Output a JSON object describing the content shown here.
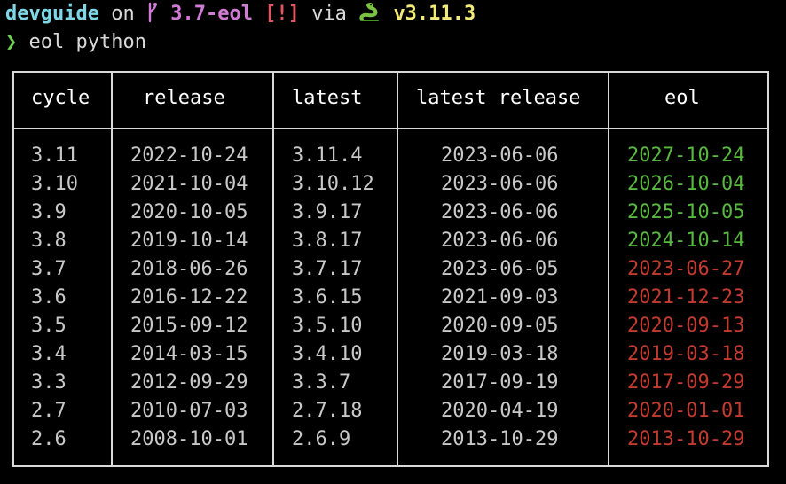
{
  "prompt": {
    "directory": "devguide",
    "on_text": "on",
    "branch_icon": "git-branch-icon",
    "branch": "3.7-eol",
    "status": "[!]",
    "via_text": "via",
    "python_icon": "python-snake-icon",
    "python_version": "v3.11.3",
    "prompt_symbol": "❯",
    "command": "eol python"
  },
  "table": {
    "headers": [
      "cycle",
      "release",
      "latest",
      "latest release",
      "eol"
    ],
    "rows": [
      {
        "cycle": "3.11",
        "release": "2022-10-24",
        "latest": "3.11.4",
        "latest_release": "2023-06-06",
        "eol": "2027-10-24",
        "eol_status": "ok"
      },
      {
        "cycle": "3.10",
        "release": "2021-10-04",
        "latest": "3.10.12",
        "latest_release": "2023-06-06",
        "eol": "2026-10-04",
        "eol_status": "ok"
      },
      {
        "cycle": "3.9",
        "release": "2020-10-05",
        "latest": "3.9.17",
        "latest_release": "2023-06-06",
        "eol": "2025-10-05",
        "eol_status": "ok"
      },
      {
        "cycle": "3.8",
        "release": "2019-10-14",
        "latest": "3.8.17",
        "latest_release": "2023-06-06",
        "eol": "2024-10-14",
        "eol_status": "ok"
      },
      {
        "cycle": "3.7",
        "release": "2018-06-26",
        "latest": "3.7.17",
        "latest_release": "2023-06-05",
        "eol": "2023-06-27",
        "eol_status": "ended"
      },
      {
        "cycle": "3.6",
        "release": "2016-12-22",
        "latest": "3.6.15",
        "latest_release": "2021-09-03",
        "eol": "2021-12-23",
        "eol_status": "ended"
      },
      {
        "cycle": "3.5",
        "release": "2015-09-12",
        "latest": "3.5.10",
        "latest_release": "2020-09-05",
        "eol": "2020-09-13",
        "eol_status": "ended"
      },
      {
        "cycle": "3.4",
        "release": "2014-03-15",
        "latest": "3.4.10",
        "latest_release": "2019-03-18",
        "eol": "2019-03-18",
        "eol_status": "ended"
      },
      {
        "cycle": "3.3",
        "release": "2012-09-29",
        "latest": "3.3.7",
        "latest_release": "2017-09-19",
        "eol": "2017-09-29",
        "eol_status": "ended"
      },
      {
        "cycle": "2.7",
        "release": "2010-07-03",
        "latest": "2.7.18",
        "latest_release": "2020-04-19",
        "eol": "2020-01-01",
        "eol_status": "ended"
      },
      {
        "cycle": "2.6",
        "release": "2008-10-01",
        "latest": "2.6.9",
        "latest_release": "2013-10-29",
        "eol": "2013-10-29",
        "eol_status": "ended"
      }
    ]
  },
  "colors": {
    "background": "#000000",
    "directory": "#7fd8e8",
    "branch": "#d17ad6",
    "status": "#e05561",
    "python_version": "#f1ea79",
    "prompt_symbol": "#6fcf50",
    "eol_ok": "#58b840",
    "eol_ended": "#c33a2e"
  }
}
